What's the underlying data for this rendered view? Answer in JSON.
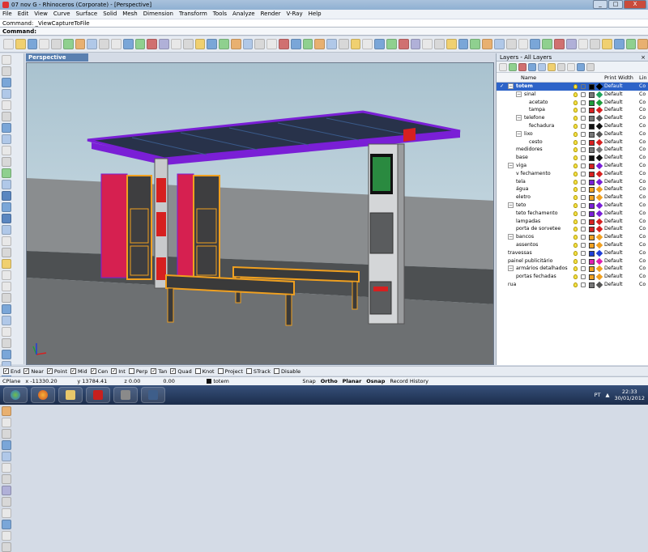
{
  "window": {
    "title": "07 nov G - Rhinoceros (Corporate) - [Perspective]",
    "buttons": [
      "_",
      "□",
      "X"
    ]
  },
  "menu": [
    "File",
    "Edit",
    "View",
    "Curve",
    "Surface",
    "Solid",
    "Mesh",
    "Dimension",
    "Transform",
    "Tools",
    "Analyze",
    "Render",
    "V-Ray",
    "Help"
  ],
  "command": {
    "history": "Command: _ViewCaptureToFile",
    "prompt": "Command:"
  },
  "viewport": {
    "label": "Perspective"
  },
  "layers": {
    "title": "Layers - All Layers",
    "columns": {
      "name": "Name",
      "print_width": "Print Width",
      "linetype": "Lin"
    },
    "rows": [
      {
        "name": "totem",
        "level": 0,
        "expand": "−",
        "color": "#000000",
        "material": "#000000",
        "print_width": "Default",
        "linetype": "Co",
        "selected": true
      },
      {
        "name": "sinal",
        "level": 1,
        "expand": "−",
        "color": "#777777",
        "material": "#1fa35c",
        "print_width": "Default",
        "linetype": "Co"
      },
      {
        "name": "acetato",
        "level": 2,
        "color": "#1e9c3b",
        "material": "#1e9c3b",
        "print_width": "Default",
        "linetype": "Co"
      },
      {
        "name": "tampa",
        "level": 2,
        "color": "#d62020",
        "material": "#d62020",
        "print_width": "Default",
        "linetype": "Co"
      },
      {
        "name": "telefone",
        "level": 1,
        "expand": "−",
        "color": "#777777",
        "material": "#555555",
        "print_width": "Default",
        "linetype": "Co"
      },
      {
        "name": "fechadura",
        "level": 2,
        "color": "#111111",
        "material": "#111111",
        "print_width": "Default",
        "linetype": "Co"
      },
      {
        "name": "lixo",
        "level": 1,
        "expand": "−",
        "color": "#777777",
        "material": "#555555",
        "print_width": "Default",
        "linetype": "Co"
      },
      {
        "name": "cesto",
        "level": 2,
        "color": "#d62020",
        "material": "#d62020",
        "print_width": "Default",
        "linetype": "Co"
      },
      {
        "name": "medidores",
        "level": 1,
        "color": "#777777",
        "material": "#777777",
        "print_width": "Default",
        "linetype": "Co"
      },
      {
        "name": "base",
        "level": 1,
        "color": "#111111",
        "material": "#111111",
        "print_width": "Default",
        "linetype": "Co"
      },
      {
        "name": "viga",
        "level": 0,
        "expand": "−",
        "color": "#d62020",
        "material": "#7a1fd6",
        "print_width": "Default",
        "linetype": "Co"
      },
      {
        "name": "v fechamento",
        "level": 1,
        "color": "#d62020",
        "material": "#d62020",
        "print_width": "Default",
        "linetype": "Co"
      },
      {
        "name": "tela",
        "level": 1,
        "color": "#7a1fd6",
        "material": "#7a1fd6",
        "print_width": "Default",
        "linetype": "Co"
      },
      {
        "name": "água",
        "level": 1,
        "color": "#f0a020",
        "material": "#f0a020",
        "print_width": "Default",
        "linetype": "Co"
      },
      {
        "name": "eletro",
        "level": 1,
        "color": "#f0a020",
        "material": "#f0a020",
        "print_width": "Default",
        "linetype": "Co"
      },
      {
        "name": "teto",
        "level": 0,
        "expand": "−",
        "color": "#7a1fd6",
        "material": "#7a1fd6",
        "print_width": "Default",
        "linetype": "Co"
      },
      {
        "name": "teto fechamento",
        "level": 1,
        "color": "#7a1fd6",
        "material": "#7a1fd6",
        "print_width": "Default",
        "linetype": "Co"
      },
      {
        "name": "lampadas",
        "level": 1,
        "color": "#d62020",
        "material": "#d62020",
        "print_width": "Default",
        "linetype": "Co"
      },
      {
        "name": "porta de sorvetee",
        "level": 1,
        "color": "#d62020",
        "material": "#d62020",
        "print_width": "Default",
        "linetype": "Co"
      },
      {
        "name": "bancos",
        "level": 0,
        "expand": "−",
        "color": "#f0a020",
        "material": "#f0a020",
        "print_width": "Default",
        "linetype": "Co"
      },
      {
        "name": "assentos",
        "level": 1,
        "color": "#f0a020",
        "material": "#f0a020",
        "print_width": "Default",
        "linetype": "Co"
      },
      {
        "name": "travessas",
        "level": 0,
        "color": "#1f3fd6",
        "material": "#1f3fd6",
        "print_width": "Default",
        "linetype": "Co"
      },
      {
        "name": "painel publicitário",
        "level": 0,
        "color": "#e020b0",
        "material": "#e020b0",
        "print_width": "Default",
        "linetype": "Co"
      },
      {
        "name": "armários detalhados",
        "level": 0,
        "expand": "−",
        "color": "#f0a020",
        "material": "#f0a020",
        "print_width": "Default",
        "linetype": "Co"
      },
      {
        "name": "portas fechadas",
        "level": 1,
        "color": "#f0a020",
        "material": "#f0a020",
        "print_width": "Default",
        "linetype": "Co"
      },
      {
        "name": "rua",
        "level": 0,
        "color": "#777777",
        "material": "#555555",
        "print_width": "Default",
        "linetype": "Co"
      }
    ]
  },
  "osnaps": [
    {
      "label": "End",
      "checked": true
    },
    {
      "label": "Near",
      "checked": true
    },
    {
      "label": "Point",
      "checked": true
    },
    {
      "label": "Mid",
      "checked": true
    },
    {
      "label": "Cen",
      "checked": true
    },
    {
      "label": "Int",
      "checked": true
    },
    {
      "label": "Perp",
      "checked": false
    },
    {
      "label": "Tan",
      "checked": true
    },
    {
      "label": "Quad",
      "checked": true
    },
    {
      "label": "Knot",
      "checked": false
    },
    {
      "label": "Project",
      "checked": false
    },
    {
      "label": "STrack",
      "checked": false
    },
    {
      "label": "Disable",
      "checked": false
    }
  ],
  "status": {
    "cplane": "CPlane",
    "x": "x -11330.20",
    "y": "y 13784.41",
    "z": "z 0.00",
    "dist": "0.00",
    "layer": "totem",
    "toggles": [
      "Snap",
      "Ortho",
      "Planar",
      "Osnap",
      "Record History"
    ]
  },
  "taskbar": {
    "language": "PT",
    "time": "22:33",
    "date": "30/01/2012"
  }
}
